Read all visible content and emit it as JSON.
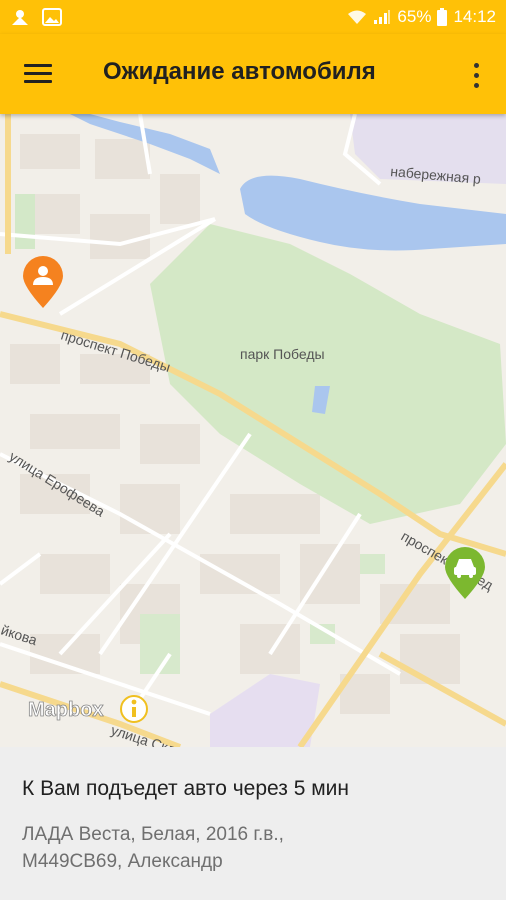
{
  "status_bar": {
    "battery": "65%",
    "time": "14:12",
    "icons": [
      "notification-icon",
      "image-icon",
      "wifi-icon",
      "signal-icon",
      "battery-icon"
    ]
  },
  "app_bar": {
    "title": "Ожидание автомобиля",
    "menu_icon": "hamburger-menu-icon",
    "overflow_icon": "more-vert-icon",
    "background": "#ffc107"
  },
  "map": {
    "labels": {
      "park": "парк Победы",
      "embankment": "набережная р",
      "prospect_left": "проспект Победы",
      "prospect_right": "проспект Побед",
      "erofeeva": "улица Ерофеева",
      "ykova": "йкова",
      "skliz": "улица Склиз"
    },
    "attribution": "Mapbox",
    "user_marker_color": "#f5821f",
    "taxi_marker_color": "#7cb82f"
  },
  "panel": {
    "eta_text": "К Вам подъедет авто через 5 мин",
    "car_line1": "ЛАДА Веста, Белая, 2016 г.в.,",
    "car_line2": "М449СВ69, Александр"
  }
}
